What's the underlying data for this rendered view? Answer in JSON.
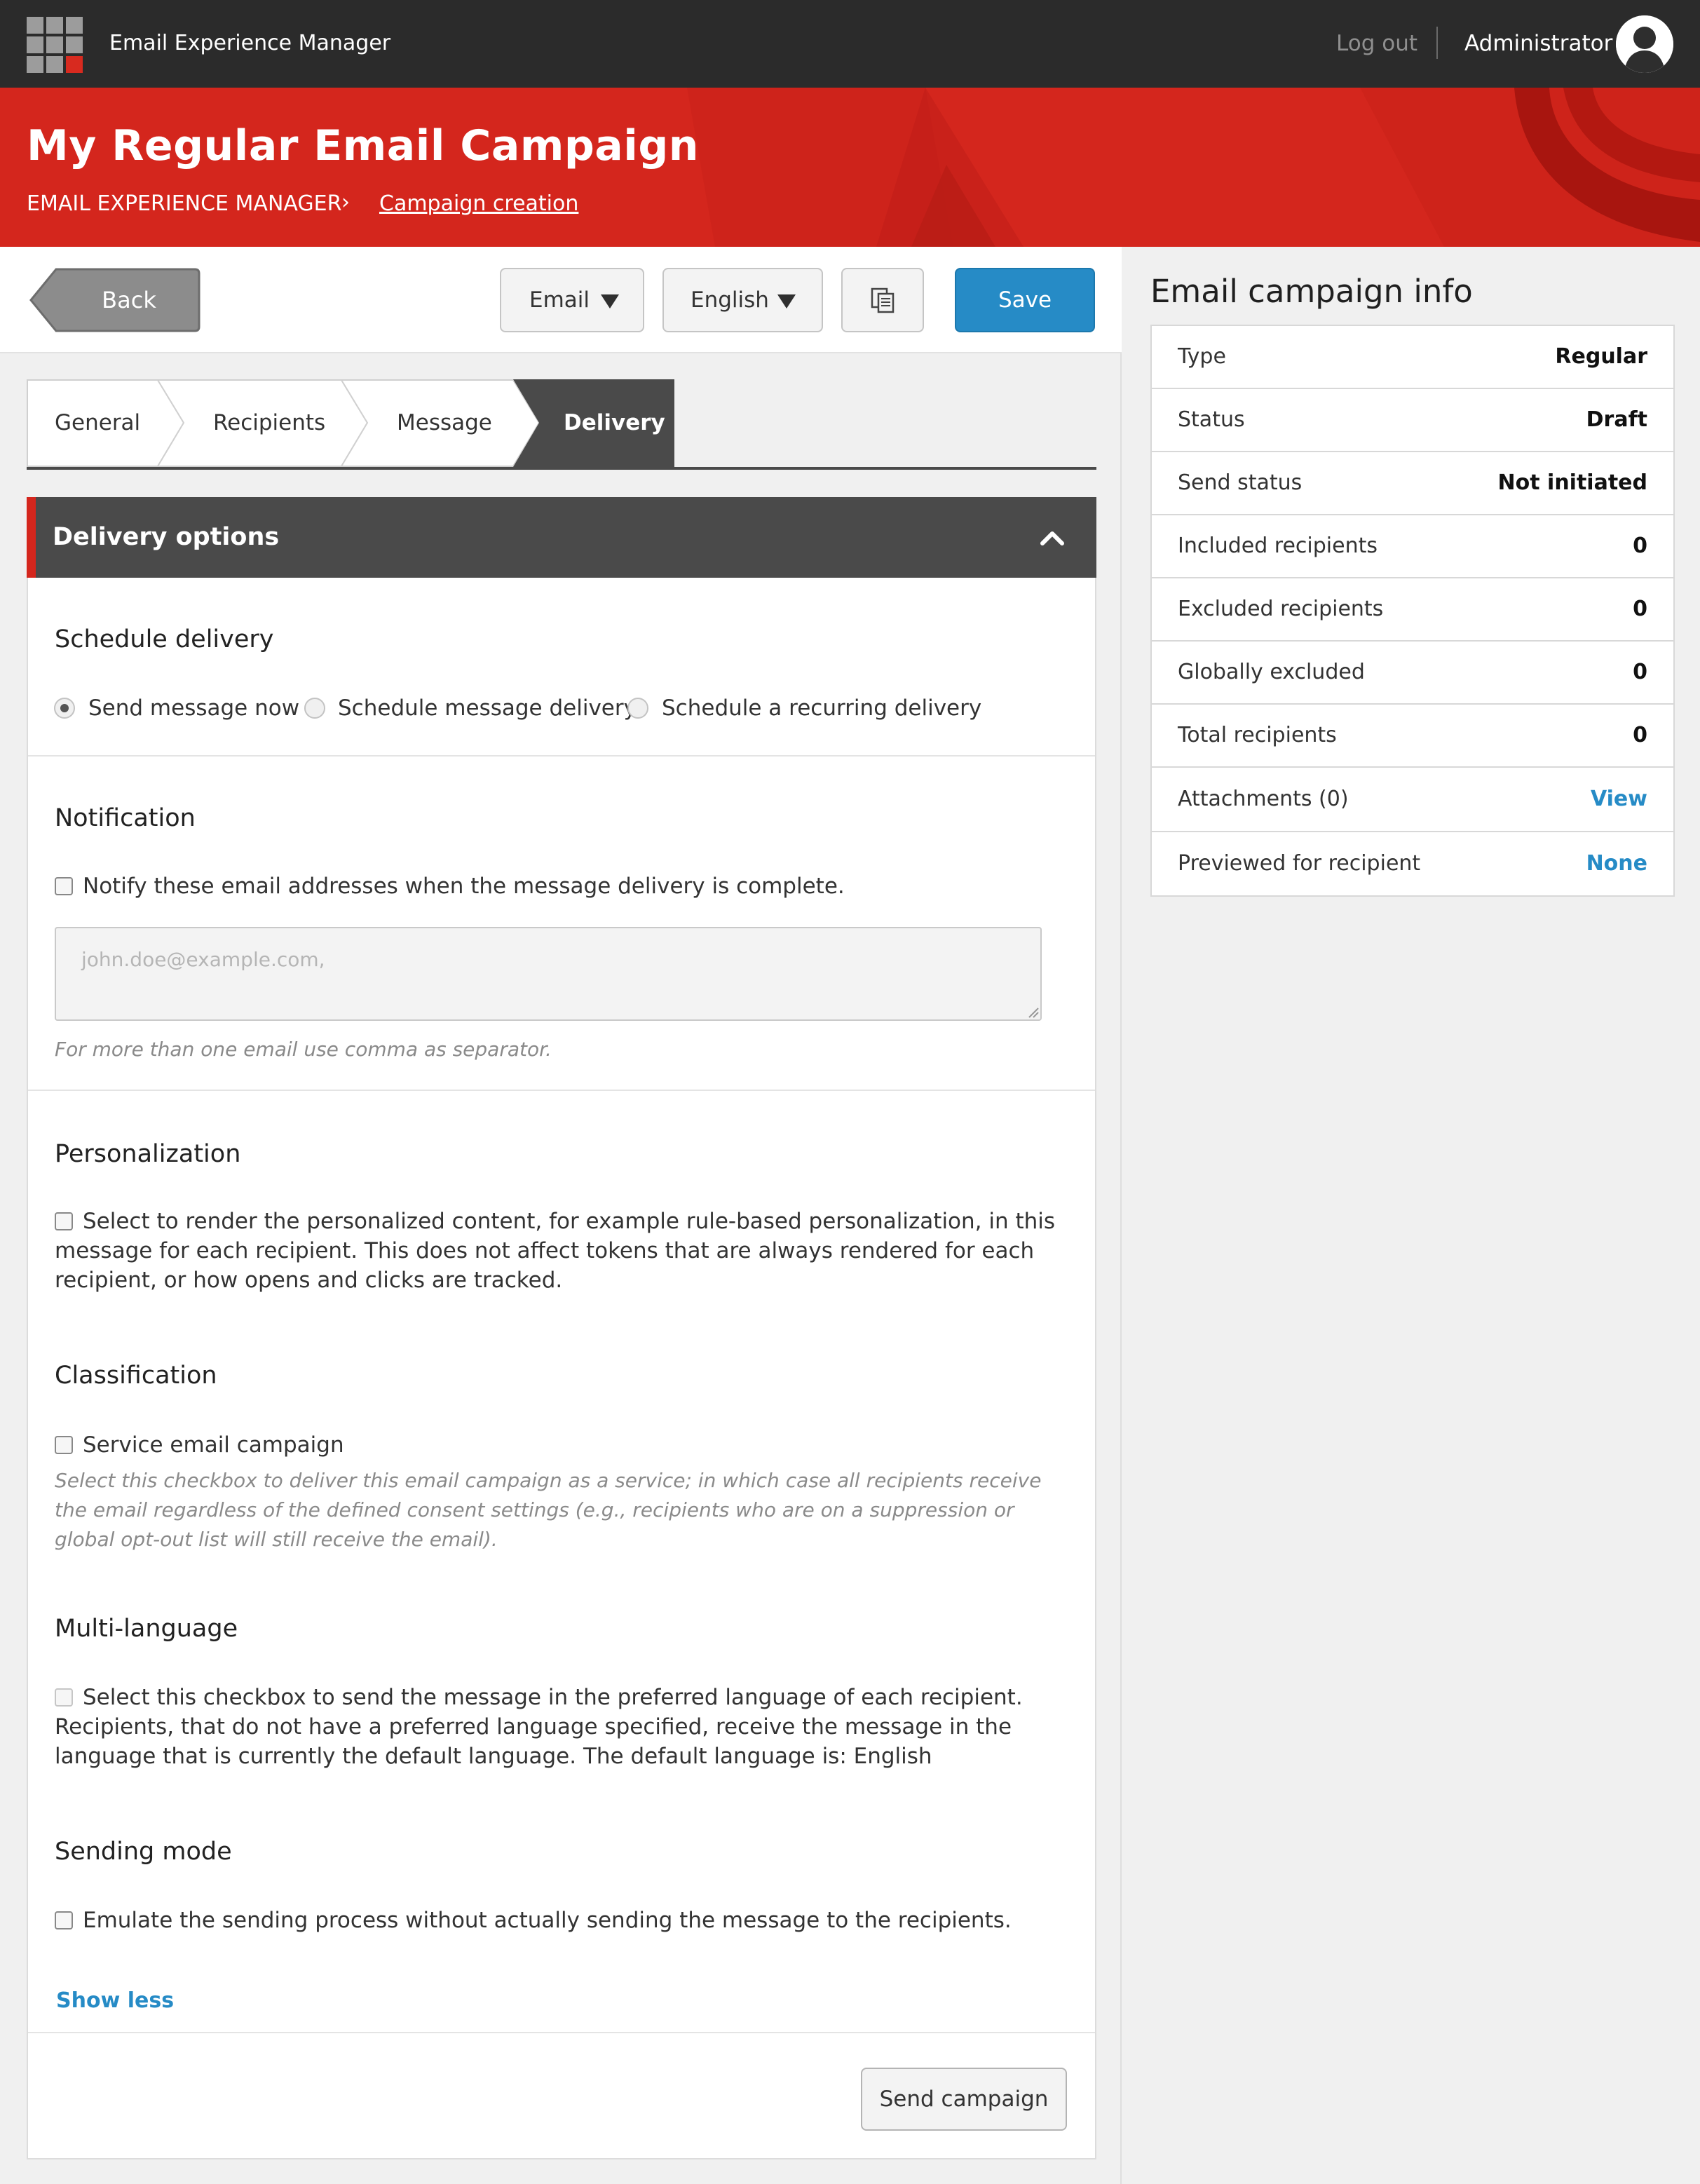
{
  "header": {
    "app_title": "Email Experience Manager",
    "logout_label": "Log out",
    "user_name": "Administrator"
  },
  "hero": {
    "title": "My Regular Email Campaign",
    "breadcrumb_root": "EMAIL EXPERIENCE MANAGER",
    "breadcrumb_separator": "›",
    "breadcrumb_current": "Campaign creation"
  },
  "toolbar": {
    "back_label": "Back",
    "channel_select": "Email",
    "language_select": "English",
    "save_label": "Save"
  },
  "tabs": [
    {
      "label": "General",
      "active": false
    },
    {
      "label": "Recipients",
      "active": false
    },
    {
      "label": "Message",
      "active": false
    },
    {
      "label": "Delivery",
      "active": true
    }
  ],
  "delivery": {
    "panel_title": "Delivery options",
    "schedule": {
      "heading": "Schedule delivery",
      "options": [
        {
          "label": "Send message now",
          "selected": true
        },
        {
          "label": "Schedule message delivery",
          "selected": false
        },
        {
          "label": "Schedule a recurring delivery",
          "selected": false
        }
      ]
    },
    "notification": {
      "heading": "Notification",
      "checkbox_label": "Notify these email addresses when the message delivery is complete.",
      "email_placeholder": "john.doe@example.com,",
      "email_value": "",
      "hint": "For more than one email use comma as separator."
    },
    "personalization": {
      "heading": "Personalization",
      "checkbox_label": "Select to render the personalized content, for example rule-based personalization, in this message for each recipient. This does not affect tokens that are always rendered for each recipient, or how opens and clicks are tracked."
    },
    "classification": {
      "heading": "Classification",
      "checkbox_label": "Service email campaign",
      "hint": "Select this checkbox to deliver this email campaign as a service; in which case all recipients receive the email regardless of the defined consent settings (e.g., recipients who are on a suppression or global opt-out list will still receive the email)."
    },
    "multilanguage": {
      "heading": "Multi-language",
      "checkbox_label": "Select this checkbox to send the message in the preferred language of each recipient. Recipients, that do not have a preferred language specified, receive the message in the language that is currently the default language. The default language is: English"
    },
    "sending_mode": {
      "heading": "Sending mode",
      "checkbox_label": "Emulate the sending process without actually sending the message to the recipients."
    },
    "show_less_label": "Show less",
    "send_button_label": "Send campaign"
  },
  "info": {
    "title": "Email campaign info",
    "rows": [
      {
        "key": "Type",
        "value": "Regular"
      },
      {
        "key": "Status",
        "value": "Draft"
      },
      {
        "key": "Send status",
        "value": "Not initiated"
      },
      {
        "key": "Included recipients",
        "value": "0"
      },
      {
        "key": "Excluded recipients",
        "value": "0"
      },
      {
        "key": "Globally excluded",
        "value": "0"
      },
      {
        "key": "Total recipients",
        "value": "0"
      },
      {
        "key": "Attachments (0)",
        "value": "View",
        "link": true
      },
      {
        "key": "Previewed for recipient",
        "value": "None",
        "link": true
      }
    ]
  },
  "colors": {
    "brand_red": "#d4261d",
    "topbar": "#2b2b2b",
    "primary_blue": "#268bc6",
    "dark_panel": "#4a4a4a"
  },
  "icons": {
    "app_logo": "app-grid-icon",
    "avatar": "user-avatar-icon",
    "copy": "copy-document-icon",
    "collapse": "chevron-up-icon"
  }
}
